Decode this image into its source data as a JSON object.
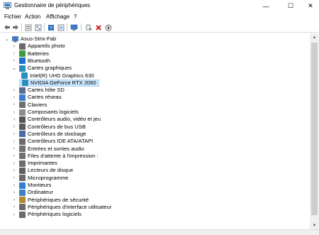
{
  "window": {
    "title": "Gestionnaire de périphériques",
    "controls": [
      "—",
      "☐",
      "✕"
    ]
  },
  "menu": [
    "Fichier",
    "Action",
    "Affichage",
    "?"
  ],
  "toolbar": {
    "buttons": [
      "back-arrow-icon",
      "forward-arrow-icon",
      "properties-icon",
      "update-list-icon",
      "help-icon",
      "show-hidden-icon",
      "scan-hardware-icon",
      "enable-device-icon",
      "uninstall-icon",
      "download-driver-icon"
    ]
  },
  "tree": {
    "root": "Asus-Strix-Fab",
    "items": [
      {
        "label": "Appareils photo",
        "expanded": false,
        "color": "#6a6a6a"
      },
      {
        "label": "Batteries",
        "expanded": false,
        "color": "#3d9a3d"
      },
      {
        "label": "Bluetooth",
        "expanded": false,
        "color": "#1e6fd0"
      },
      {
        "label": "Cartes graphiques",
        "expanded": true,
        "color": "#2a8fbf",
        "children": [
          {
            "label": "Intel(R) UHD Graphics 630",
            "selected": false
          },
          {
            "label": "NVIDIA GeForce RTX 2060",
            "selected": true
          }
        ]
      },
      {
        "label": "Cartes hôte SD",
        "expanded": false,
        "color": "#5a6e8c"
      },
      {
        "label": "Cartes réseau",
        "expanded": false,
        "color": "#3a7ccf"
      },
      {
        "label": "Claviers",
        "expanded": false,
        "color": "#707070"
      },
      {
        "label": "Composants logiciels",
        "expanded": false,
        "color": "#8c8c8c"
      },
      {
        "label": "Contrôleurs audio, vidéo et jeu",
        "expanded": false,
        "color": "#555555"
      },
      {
        "label": "Contrôleurs de bus USB",
        "expanded": false,
        "color": "#5a5a5a"
      },
      {
        "label": "Contrôleurs de stockage",
        "expanded": false,
        "color": "#4a6aa8"
      },
      {
        "label": "Contrôleurs IDE ATA/ATAPI",
        "expanded": false,
        "color": "#6a6a6a"
      },
      {
        "label": "Entrées et sorties audio",
        "expanded": false,
        "color": "#707070"
      },
      {
        "label": "Files d'attente à l'impression :",
        "expanded": false,
        "color": "#707070"
      },
      {
        "label": "Imprimantes",
        "expanded": false,
        "color": "#6c6c6c"
      },
      {
        "label": "Lecteurs de disque",
        "expanded": false,
        "color": "#606060"
      },
      {
        "label": "Microprogramme",
        "expanded": false,
        "color": "#6a6a6a"
      },
      {
        "label": "Moniteurs",
        "expanded": false,
        "color": "#2f7fd0"
      },
      {
        "label": "Ordinateur",
        "expanded": false,
        "color": "#3f80c8"
      },
      {
        "label": "Périphériques de sécurité",
        "expanded": false,
        "color": "#b08a30"
      },
      {
        "label": "Périphériques d'interface utilisateur",
        "expanded": false,
        "color": "#6a6a6a"
      },
      {
        "label": "Périphériques logiciels",
        "expanded": false,
        "color": "#6a6a6a"
      }
    ]
  }
}
